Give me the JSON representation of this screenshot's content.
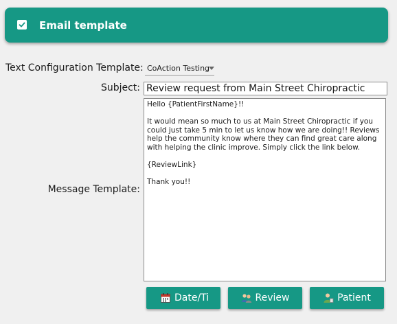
{
  "header": {
    "title": "Email template",
    "checked": true,
    "color": "#169885"
  },
  "form": {
    "template_label": "Text Configuration Template:",
    "template_value": "CoAction Testing",
    "subject_label": "Subject:",
    "subject_value": "Review request from Main Street Chiropractic",
    "message_label": "Message Template:",
    "message_value": "Hello {PatientFirstName}!!\n\nIt would mean so much to us at Main Street Chiropractic if you could just take 5 min to let us know how we are doing!! Reviews help the community know where they can find great care along with helping the clinic improve. Simply click the link below.\n\n{ReviewLink}\n\nThank you!!"
  },
  "buttons": {
    "date_label": "Date/Ti",
    "date_icon": "calendar-icon",
    "review_label": "Review",
    "review_icon": "people-icon",
    "patient_label": "Patient",
    "patient_icon": "person-icon"
  }
}
